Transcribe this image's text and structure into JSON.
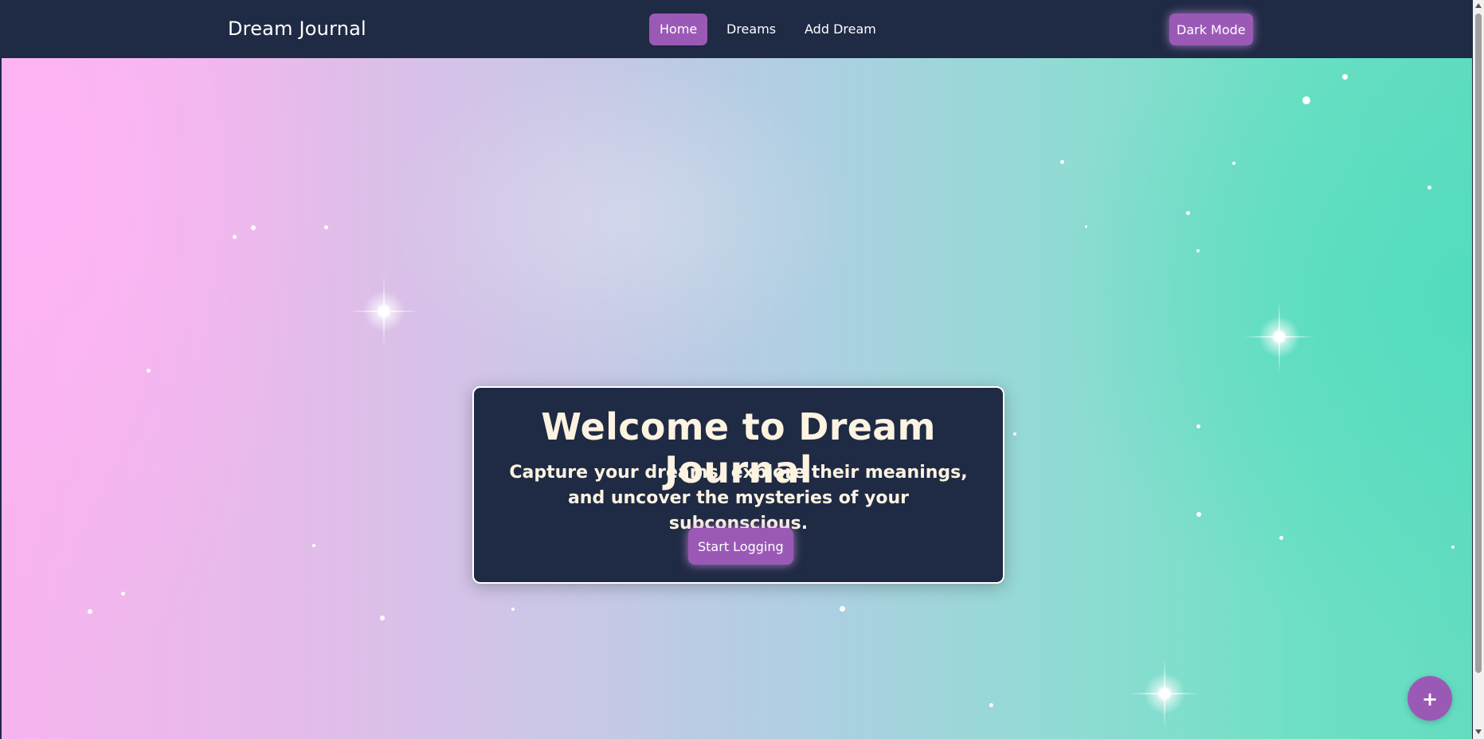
{
  "nav": {
    "brand": "Dream Journal",
    "items": [
      {
        "label": "Home",
        "active": true
      },
      {
        "label": "Dreams",
        "active": false
      },
      {
        "label": "Add Dream",
        "active": false
      }
    ],
    "dark_mode_label": "Dark Mode"
  },
  "hero": {
    "title": "Welcome to Dream Journal",
    "subtitle": "Capture your dreams, explore their meanings, and uncover the mysteries of your subconscious.",
    "cta_label": "Start Logging"
  },
  "fab": {
    "label": "+",
    "icon": "plus-icon"
  },
  "colors": {
    "nav_background": "#1f2a44",
    "accent": "#9b59b6",
    "card_text": "#fdf3e1"
  }
}
